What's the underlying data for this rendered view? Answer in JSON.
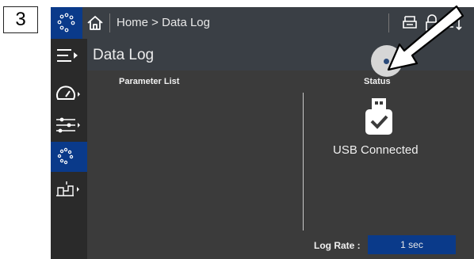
{
  "step_number": "3",
  "breadcrumb": "Home > Data Log",
  "page_title": "Data Log",
  "parameter_list_header": "Parameter List",
  "status_header": "Status",
  "usb_status": "USB Connected",
  "log_rate": {
    "label": "Log Rate :",
    "value": "1 sec"
  },
  "colors": {
    "accent_blue": "#0a3a8a",
    "bar_gray": "#3a3f45",
    "body_gray": "#3b3b3b"
  }
}
